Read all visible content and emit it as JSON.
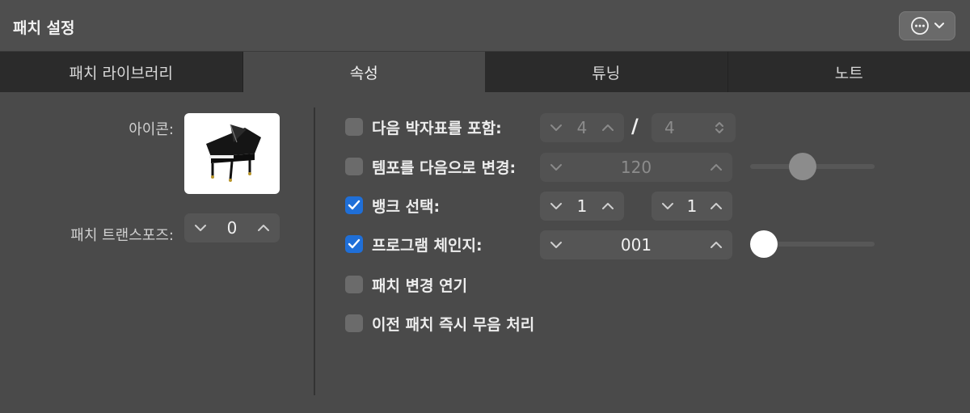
{
  "window": {
    "title": "패치 설정"
  },
  "header": {
    "more_icon": "ellipsis-circle-icon",
    "chevron_icon": "chevron-down-icon"
  },
  "tabs": [
    {
      "label": "패치 라이브러리",
      "active": false
    },
    {
      "label": "속성",
      "active": true
    },
    {
      "label": "튜닝",
      "active": false
    },
    {
      "label": "노트",
      "active": false
    }
  ],
  "left": {
    "icon_label": "아이콘:",
    "icon_image": "grand-piano-icon",
    "transpose_label": "패치 트랜스포즈:",
    "transpose_value": "0"
  },
  "options": {
    "time_signature": {
      "label": "다음 박자표를 포함:",
      "checked": false,
      "numerator": "4",
      "separator": "/",
      "denominator": "4"
    },
    "tempo": {
      "label": "템포를 다음으로 변경:",
      "checked": false,
      "value": "120",
      "slider_level": 0.4
    },
    "bank": {
      "label": "뱅크 선택:",
      "checked": true,
      "msb": "1",
      "lsb": "1"
    },
    "program": {
      "label": "프로그램 체인지:",
      "checked": true,
      "value": "001",
      "slider_level": 0.0
    },
    "delay": {
      "label": "패치 변경 연기",
      "checked": false
    },
    "mute": {
      "label": "이전 패치 즉시 무음 처리",
      "checked": false
    }
  },
  "colors": {
    "accent": "#1f6fd8",
    "background": "#4a4a4a",
    "tab_inactive": "#2b2b2b"
  }
}
